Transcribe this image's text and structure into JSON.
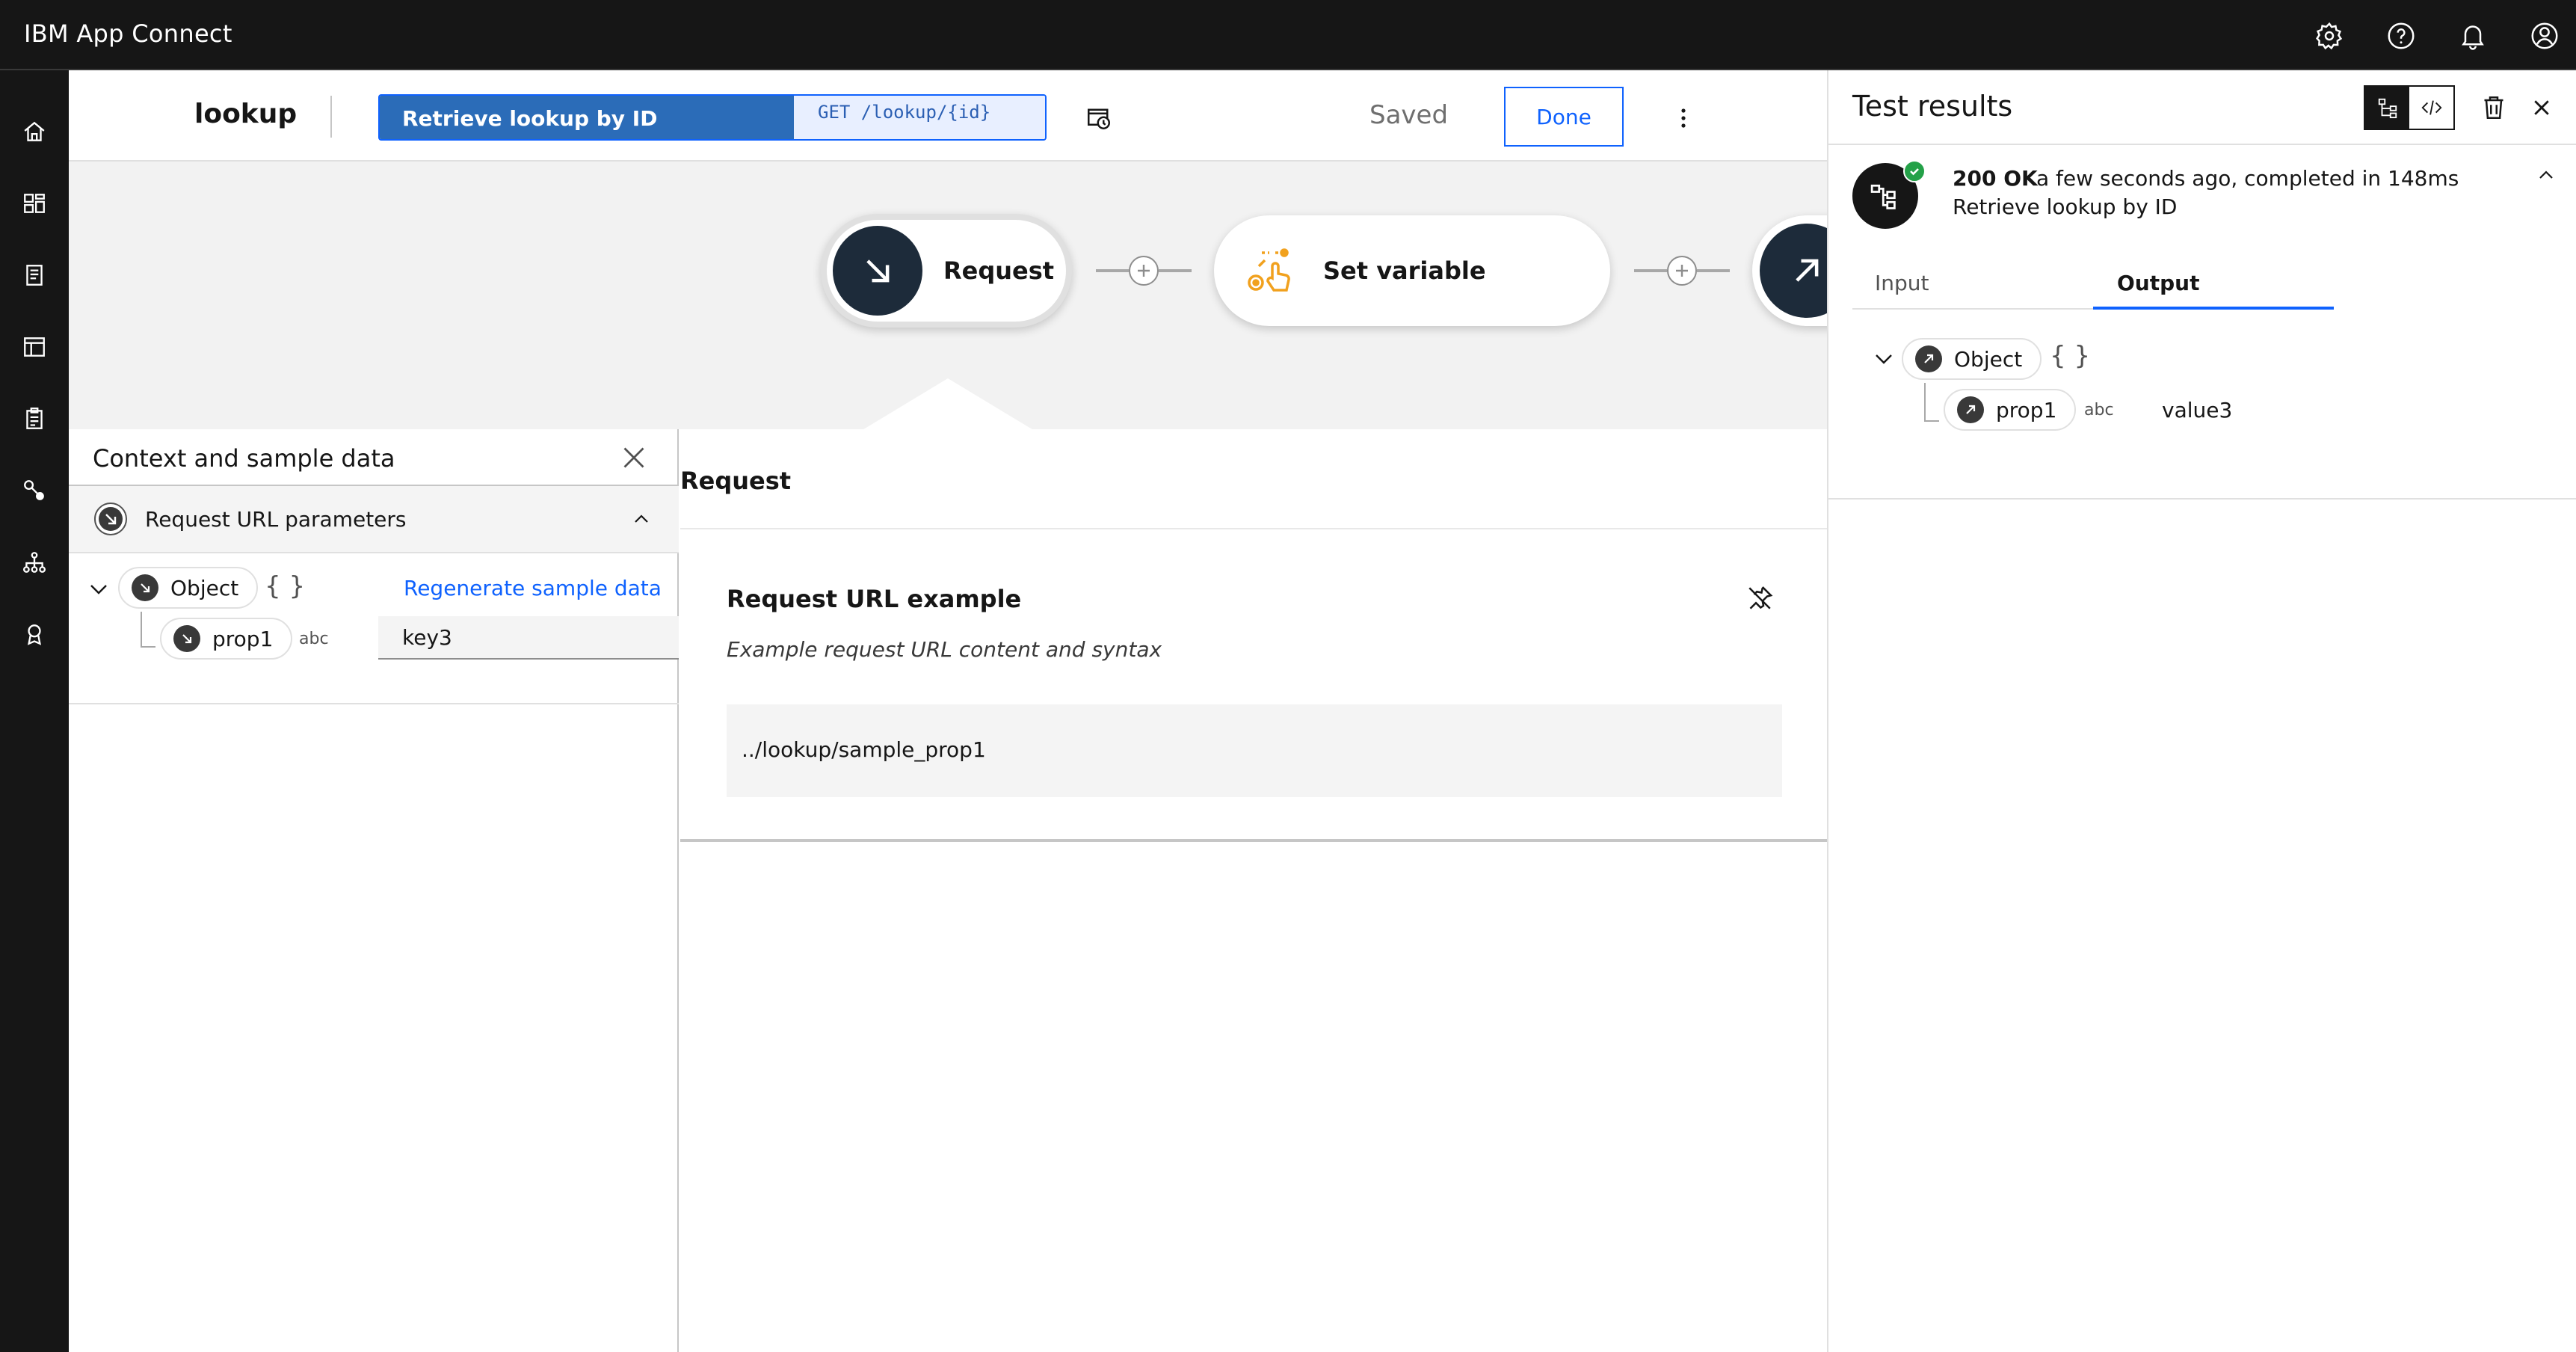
{
  "app": {
    "title": "IBM App Connect"
  },
  "topbar": {
    "icons": [
      "settings-icon",
      "help-icon",
      "notification-icon",
      "user-avatar-icon"
    ]
  },
  "rail": {
    "icons": [
      "home-icon",
      "dashboard-icon",
      "catalog-icon",
      "templates-icon",
      "clipboard-icon",
      "connections-icon",
      "hierarchy-icon",
      "badge-icon"
    ]
  },
  "header": {
    "flow_name": "lookup",
    "operation_name": "Retrieve lookup by ID",
    "operation_path": "GET /lookup/{id}",
    "status": "Saved",
    "done_label": "Done"
  },
  "canvas": {
    "nodes": [
      {
        "label": "Request"
      },
      {
        "label": "Set variable"
      }
    ]
  },
  "context_panel": {
    "title": "Context and sample data",
    "section_label": "Request URL parameters",
    "object_label": "Object",
    "braces": "{ }",
    "regenerate_label": "Regenerate sample data",
    "prop_label": "prop1",
    "prop_type": "abc",
    "prop_value": "key3"
  },
  "request_panel": {
    "title": "Request",
    "card_title": "Request URL example",
    "card_description": "Example request URL content and syntax",
    "example_url": "../lookup/sample_prop1"
  },
  "test_results": {
    "title": "Test results",
    "status_code": "200 OK",
    "status_detail": "a few seconds ago, completed in 148ms",
    "operation": "Retrieve lookup by ID",
    "tabs": [
      {
        "label": "Input",
        "selected": false
      },
      {
        "label": "Output",
        "selected": true
      }
    ],
    "object_label": "Object",
    "braces": "{ }",
    "prop_label": "prop1",
    "prop_type": "abc",
    "prop_value": "value3"
  },
  "colors": {
    "accent": "#0f62fe",
    "dark": "#161616",
    "node_dark": "#1d2b3a",
    "success": "#24a148",
    "setvar_icon": "#f1a11e"
  }
}
